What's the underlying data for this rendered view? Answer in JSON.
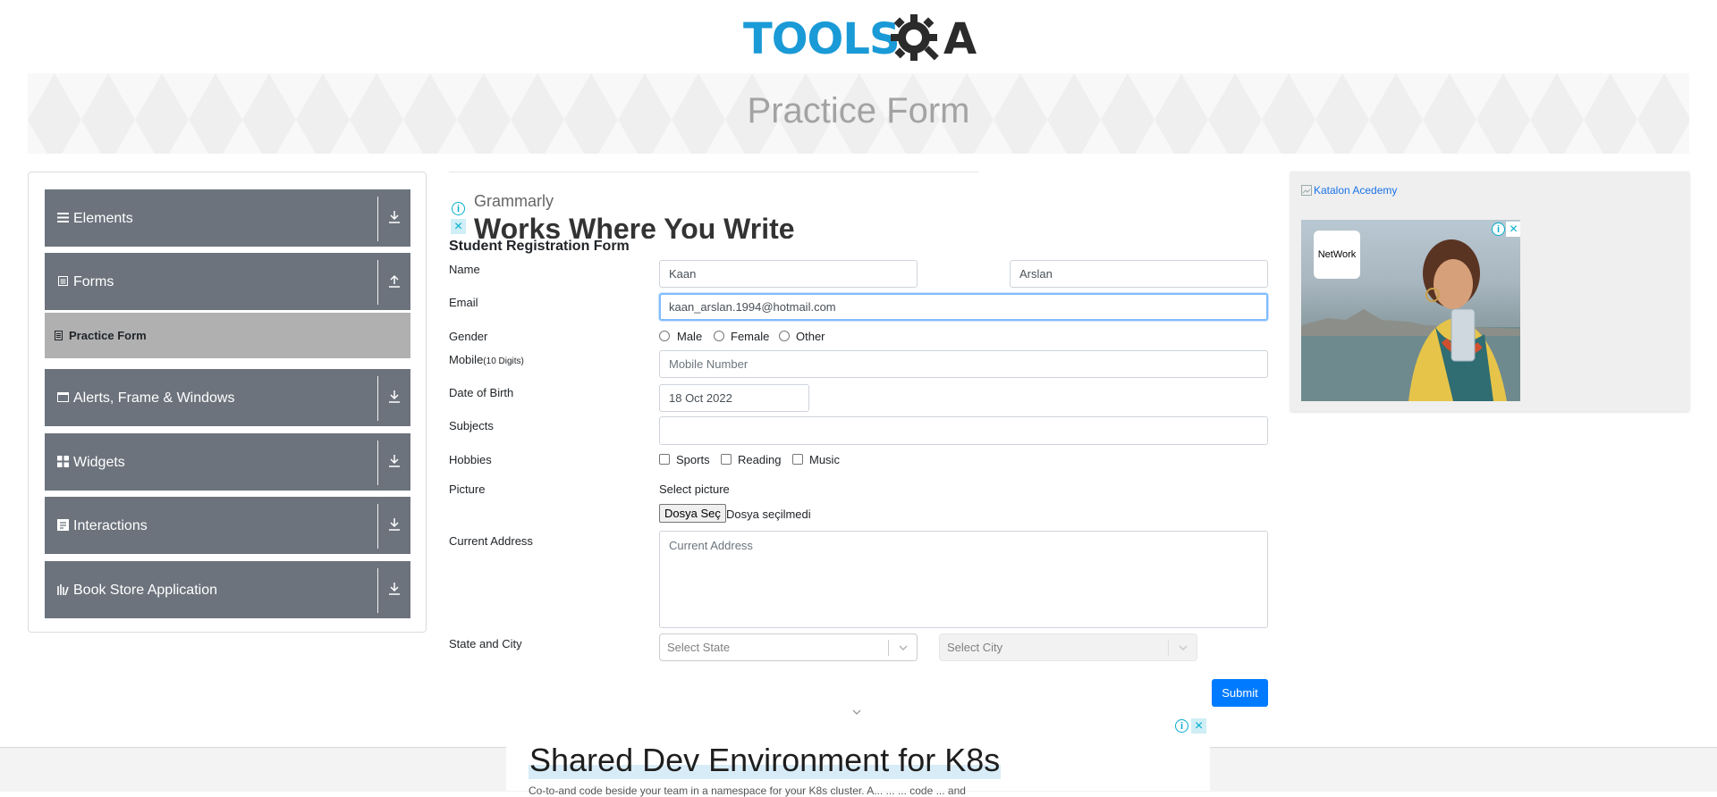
{
  "header": {
    "logo_text": "TOOLS",
    "logo_suffix": "A"
  },
  "banner": {
    "title": "Practice Form"
  },
  "sidebar": {
    "groups": [
      {
        "label": "Elements",
        "icon": "hamburger-icon",
        "arrow": "download-icon"
      },
      {
        "label": "Forms",
        "icon": "form-icon",
        "arrow": "upload-icon"
      },
      {
        "label": "Alerts, Frame & Windows",
        "icon": "window-icon",
        "arrow": "download-icon"
      },
      {
        "label": "Widgets",
        "icon": "grid-icon",
        "arrow": "download-icon"
      },
      {
        "label": "Interactions",
        "icon": "interaction-icon",
        "arrow": "download-icon"
      },
      {
        "label": "Book Store Application",
        "icon": "books-icon",
        "arrow": "download-icon"
      }
    ],
    "active_subitem": "Practice Form"
  },
  "ad_top": {
    "brand": "Grammarly",
    "headline": "Works Where You Write"
  },
  "form": {
    "title": "Student Registration Form",
    "name_label": "Name",
    "first_name": "Kaan",
    "last_name": "Arslan",
    "email_label": "Email",
    "email_value": "kaan_arslan.1994@hotmail.com",
    "gender_label": "Gender",
    "gender_options": [
      "Male",
      "Female",
      "Other"
    ],
    "mobile_label": "Mobile",
    "mobile_hint": "(10 Digits)",
    "mobile_placeholder": "Mobile Number",
    "dob_label": "Date of Birth",
    "dob_value": "18 Oct 2022",
    "subjects_label": "Subjects",
    "hobbies_label": "Hobbies",
    "hobby_options": [
      "Sports",
      "Reading",
      "Music"
    ],
    "picture_label": "Picture",
    "picture_hint": "Select picture",
    "file_button": "Dosya Seç",
    "file_status": "Dosya seçilmedi",
    "address_label": "Current Address",
    "address_placeholder": "Current Address",
    "state_city_label": "State and City",
    "state_placeholder": "Select State",
    "city_placeholder": "Select City",
    "submit_label": "Submit"
  },
  "ad_right": {
    "link_text": "Katalon Acedemy",
    "badge": "NetWork"
  },
  "ad_bottom": {
    "headline": "Shared Dev Environment for K8s",
    "subline": "Co-to-and code beside your team in a namespace for your K8s cluster. A... ... ... code ... and"
  },
  "colors": {
    "accent": "#007bff",
    "sidebar": "#6c737d",
    "active": "#b0b0b0",
    "logo": "#1a9ad6"
  }
}
